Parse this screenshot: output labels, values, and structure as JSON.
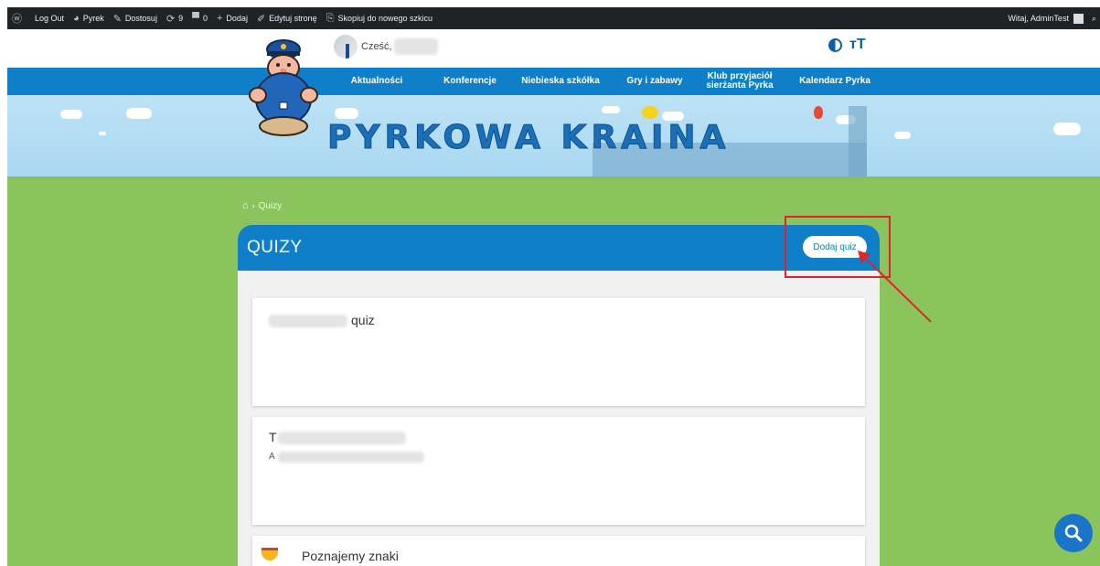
{
  "adminbar": {
    "items": [
      {
        "icon": "wordpress-icon",
        "label": ""
      },
      {
        "icon": "",
        "label": "Log Out"
      },
      {
        "icon": "palette-icon",
        "label": "Pyrek"
      },
      {
        "icon": "brush-icon",
        "label": "Dostosuj"
      },
      {
        "icon": "updates-icon",
        "label": "9"
      },
      {
        "icon": "comment-icon",
        "label": "0"
      },
      {
        "icon": "plus-icon",
        "label": "Dodaj"
      },
      {
        "icon": "pencil-icon",
        "label": "Edytuj stronę"
      },
      {
        "icon": "copy-icon",
        "label": "Skopiuj do nowego szkicu"
      }
    ],
    "greeting": "Witaj, AdminTest"
  },
  "header": {
    "greeting": "Cześć,",
    "font_size_icon": "ᴛT"
  },
  "nav": {
    "items": [
      "Aktualności",
      "Konferencje",
      "Niebieska szkółka",
      "Gry i zabawy",
      "Klub przyjaciół sierżanta Pyrka",
      "Kalendarz Pyrka"
    ]
  },
  "banner": {
    "title": "PYRKOWA KRAINA"
  },
  "breadcrumb": {
    "current": "Quizy"
  },
  "panel": {
    "title": "QUIZY",
    "add_button": "Dodaj quiz"
  },
  "cards": [
    {
      "title": "quiz"
    },
    {
      "title": "T",
      "subtitle": "A"
    },
    {
      "title": "Poznajemy znaki"
    }
  ],
  "colors": {
    "primary_blue": "#0e7fc8",
    "grass_green": "#8bc45d",
    "annotation_red": "#e2242a"
  }
}
